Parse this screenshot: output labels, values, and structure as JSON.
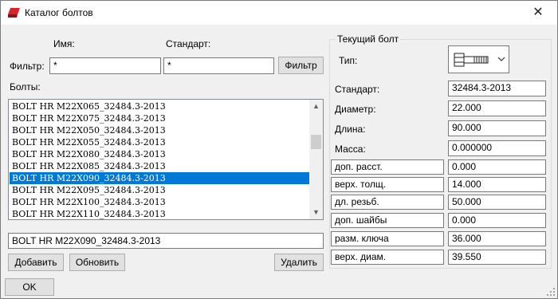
{
  "window": {
    "title": "Каталог болтов",
    "close_glyph": "✕"
  },
  "filter": {
    "name_header": "Имя:",
    "standard_header": "Стандарт:",
    "label": "Фильтр:",
    "name_value": "*",
    "standard_value": "*",
    "button": "Фильтр"
  },
  "bolts": {
    "label": "Болты:",
    "items": [
      "BOLT HR M22X065_32484.3-2013",
      "BOLT HR M22X075_32484.3-2013",
      "BOLT HR M22X050_32484.3-2013",
      "BOLT HR M22X055_32484.3-2013",
      "BOLT HR M22X080_32484.3-2013",
      "BOLT HR M22X085_32484.3-2013",
      "BOLT HR M22X090_32484.3-2013",
      "BOLT HR M22X095_32484.3-2013",
      "BOLT HR M22X100_32484.3-2013",
      "BOLT HR M22X110_32484.3-2013"
    ],
    "selected_index": 6,
    "selected_value": "BOLT HR M22X090_32484.3-2013"
  },
  "buttons": {
    "add": "Добавить",
    "update": "Обновить",
    "delete": "Удалить",
    "ok": "OK"
  },
  "current_bolt": {
    "title": "Текущий болт",
    "type_label": "Тип:",
    "type_icon": "bolt-icon",
    "fields": [
      {
        "label": "Стандарт:",
        "value": "32484.3-2013"
      },
      {
        "label": "Диаметр:",
        "value": "22.000"
      },
      {
        "label": "Длина:",
        "value": "90.000"
      },
      {
        "label": "Масса:",
        "value": "0.000000"
      }
    ],
    "params": [
      {
        "label": "доп. расст.",
        "value": "0.000"
      },
      {
        "label": "верх. толщ.",
        "value": "14.000"
      },
      {
        "label": "дл. резьб.",
        "value": "50.000"
      },
      {
        "label": "доп. шайбы",
        "value": "0.000"
      },
      {
        "label": "разм. ключа",
        "value": "36.000"
      },
      {
        "label": "верх. диам.",
        "value": "39.550"
      }
    ]
  },
  "colors": {
    "selection": "#0078d7",
    "icon_red": "#d9232d"
  }
}
